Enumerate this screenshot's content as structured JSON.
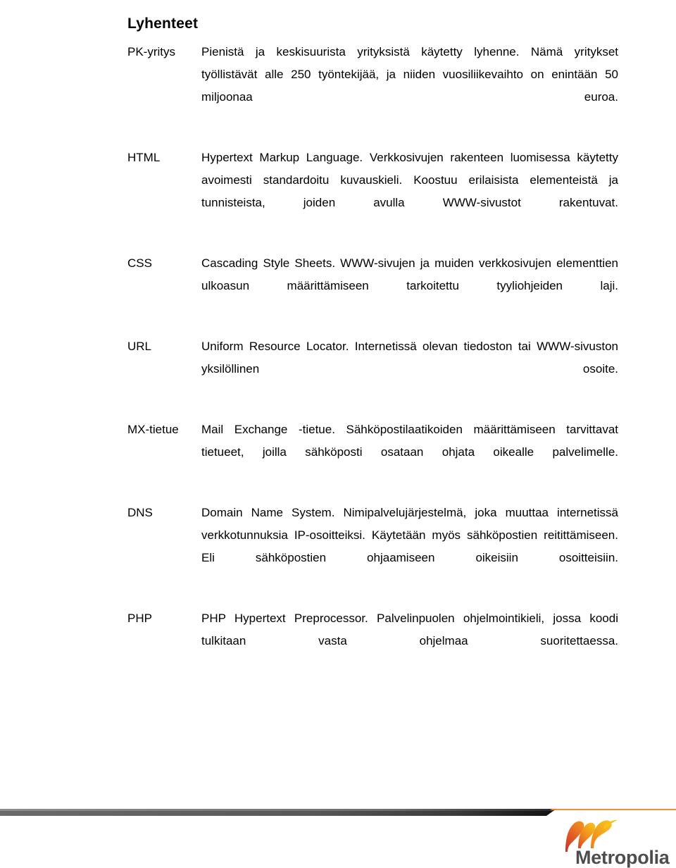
{
  "document": {
    "title": "Lyhenteet",
    "language": "fi"
  },
  "glossary": {
    "entries": [
      {
        "term": "PK-yritys",
        "definition": "Pienistä ja keskisuurista yrityksistä käytetty lyhenne. Nämä yritykset työllistävät alle 250 työntekijää, ja niiden vuosiliikevaihto on enintään 50 miljoonaa euroa."
      },
      {
        "term": "HTML",
        "definition": "Hypertext Markup Language. Verkkosivujen rakenteen luomisessa käytetty avoimesti standardoitu kuvauskieli. Koostuu erilaisista elementeistä ja tunnisteista, joiden avulla WWW-sivustot rakentuvat."
      },
      {
        "term": "CSS",
        "definition": "Cascading Style Sheets. WWW-sivujen ja muiden verkkosivujen elementtien ulkoasun määrittämiseen tarkoitettu tyyliohjeiden laji."
      },
      {
        "term": "URL",
        "definition": "Uniform Resource Locator. Internetissä olevan tiedoston tai WWW-sivuston yksilöllinen osoite."
      },
      {
        "term": "MX-tietue",
        "definition": "Mail Exchange -tietue. Sähköpostilaatikoiden määrittämiseen tarvittavat tietueet, joilla sähköposti osataan ohjata oikealle palvelimelle."
      },
      {
        "term": "DNS",
        "definition": "Domain Name System. Nimipalvelujärjestelmä, joka muuttaa internetissä verkkotunnuksia IP-osoitteiksi. Käytetään myös sähköpostien reitittämiseen. Eli sähköpostien ohjaamiseen oikeisiin osoitteisiin."
      },
      {
        "term": "PHP",
        "definition": "PHP Hypertext Preprocessor. Palvelinpuolen ohjelmointikieli, jossa koodi tulkitaan vasta ohjelmaa suoritettaessa."
      }
    ]
  },
  "footer": {
    "logo": {
      "wordmark": "Metropolia",
      "swoosh_icon": "metropolia-swoosh-icon",
      "colors": {
        "swoosh_red": "#d5382a",
        "swoosh_orange": "#ef7c1a",
        "swoosh_yellow": "#f5b81c",
        "wordmark_gray": "#4d4d4f"
      }
    },
    "rule": {
      "bar_color_dark": "#58585b",
      "bar_color_black": "#1a1a1a",
      "accent_color": "#f0892a"
    }
  }
}
